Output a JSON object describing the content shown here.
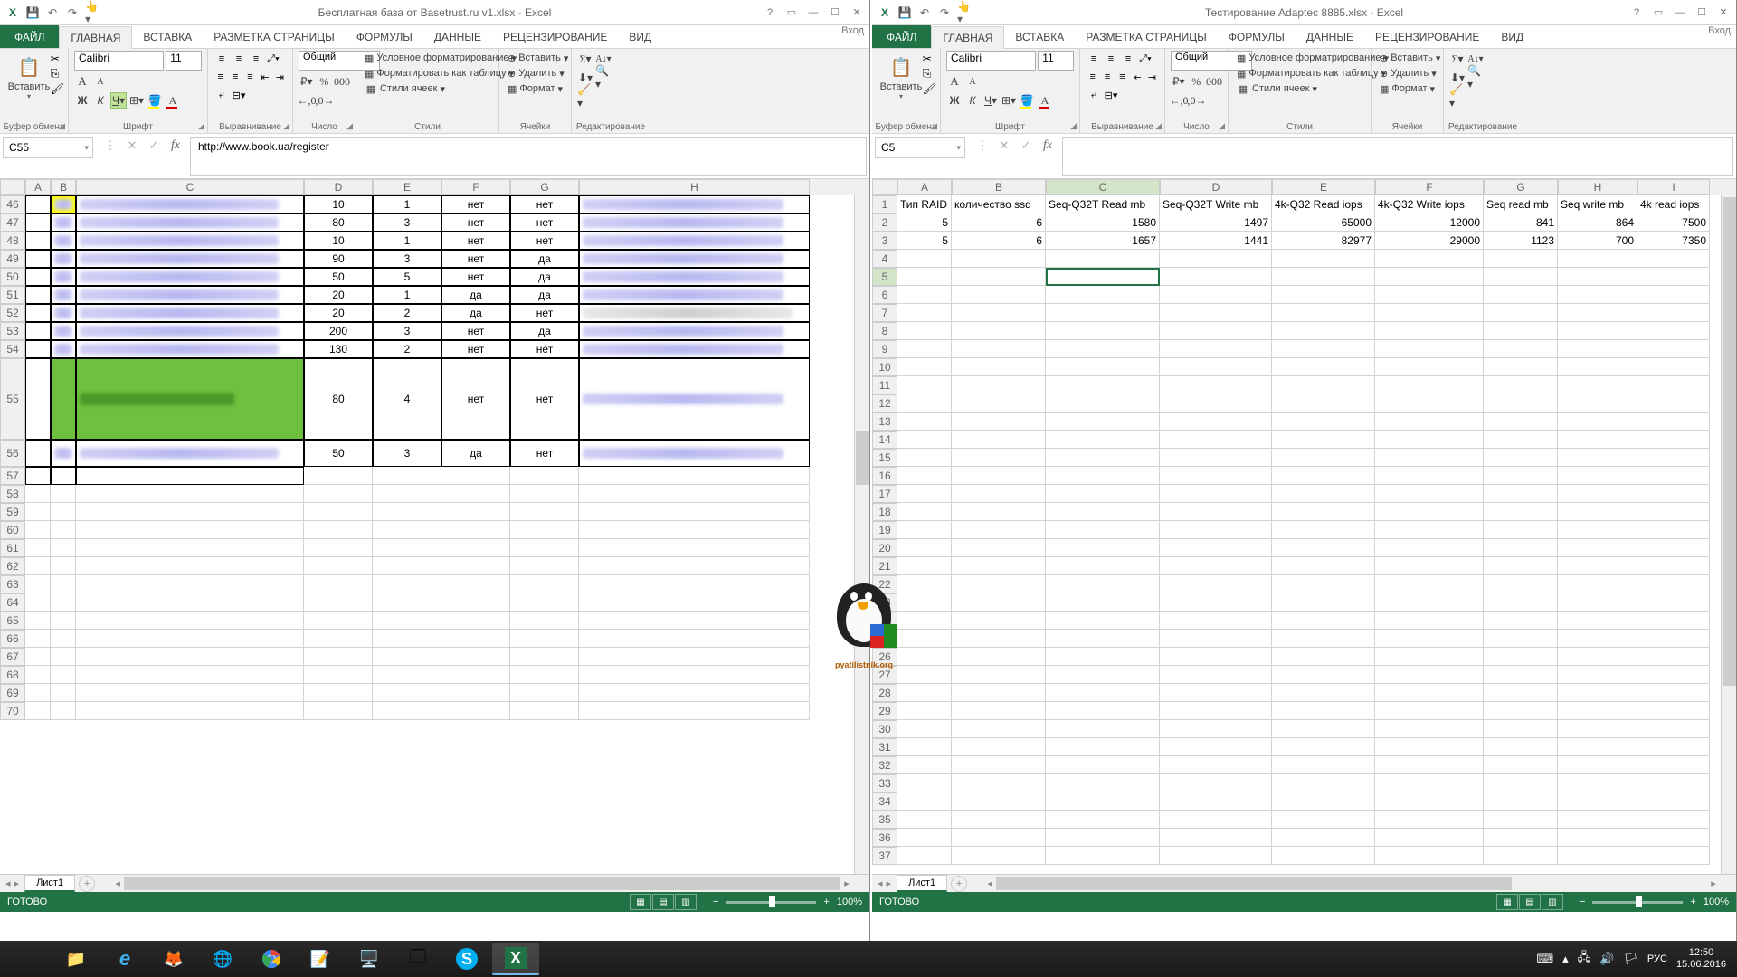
{
  "left": {
    "title": "Бесплатная база от Basetrust.ru v1.xlsx - Excel",
    "signin": "Вход",
    "tabs": {
      "file": "ФАЙЛ",
      "home": "ГЛАВНАЯ",
      "insert": "ВСТАВКА",
      "layout": "РАЗМЕТКА СТРАНИЦЫ",
      "formulas": "ФОРМУЛЫ",
      "data": "ДАННЫЕ",
      "review": "РЕЦЕНЗИРОВАНИЕ",
      "view": "ВИД"
    },
    "ribbon": {
      "paste": "Вставить",
      "clipboard_label": "Буфер обмена",
      "font_name": "Calibri",
      "font_size": "11",
      "font_label": "Шрифт",
      "alignment_label": "Выравнивание",
      "num_format": "Общий",
      "number_label": "Число",
      "cond_fmt": "Условное форматрирование",
      "as_table": "Форматировать как таблицу",
      "cell_styles": "Стили ячеек",
      "styles_label": "Стили",
      "insert": "Вставить",
      "delete": "Удалить",
      "format": "Формат",
      "cells_label": "Ячейки",
      "editing_label": "Редактирование"
    },
    "name_box": "C55",
    "formula": "http://www.book.ua/register",
    "cols": [
      "A",
      "B",
      "C",
      "D",
      "E",
      "F",
      "G",
      "H"
    ],
    "row_nums": [
      46,
      47,
      48,
      49,
      50,
      51,
      52,
      53,
      54,
      55,
      56,
      57,
      58,
      59,
      60,
      61,
      62,
      63,
      64,
      65,
      66,
      67,
      68,
      69,
      70
    ],
    "rows": [
      {
        "n": 46,
        "d": "10",
        "e": "1",
        "f": "нет",
        "g": "нет",
        "hlink": true,
        "yellow": true
      },
      {
        "n": 47,
        "d": "80",
        "e": "3",
        "f": "нет",
        "g": "нет",
        "hlink": true
      },
      {
        "n": 48,
        "d": "10",
        "e": "1",
        "f": "нет",
        "g": "нет",
        "hlink": true
      },
      {
        "n": 49,
        "d": "90",
        "e": "3",
        "f": "нет",
        "g": "да",
        "hlink": true
      },
      {
        "n": 50,
        "d": "50",
        "e": "5",
        "f": "нет",
        "g": "да",
        "hlink": true
      },
      {
        "n": 51,
        "d": "20",
        "e": "1",
        "f": "да",
        "g": "да",
        "hlink": true
      },
      {
        "n": 52,
        "d": "20",
        "e": "2",
        "f": "да",
        "g": "нет",
        "hgrey": true
      },
      {
        "n": 53,
        "d": "200",
        "e": "3",
        "f": "нет",
        "g": "да",
        "hlink": true
      },
      {
        "n": 54,
        "d": "130",
        "e": "2",
        "f": "нет",
        "g": "нет",
        "hlink": true
      },
      {
        "n": 55,
        "d": "80",
        "e": "4",
        "f": "нет",
        "g": "нет",
        "hlink": true,
        "tall": true,
        "green": true
      },
      {
        "n": 56,
        "d": "50",
        "e": "3",
        "f": "да",
        "g": "нет",
        "hlink": true
      }
    ],
    "sheet_tab": "Лист1",
    "status": "ГОТОВО",
    "zoom": "100%"
  },
  "right": {
    "title": "Тестирование Adaptec 8885.xlsx - Excel",
    "signin": "Вход",
    "tabs": {
      "file": "ФАЙЛ",
      "home": "ГЛАВНАЯ",
      "insert": "ВСТАВКА",
      "layout": "РАЗМЕТКА СТРАНИЦЫ",
      "formulas": "ФОРМУЛЫ",
      "data": "ДАННЫЕ",
      "review": "РЕЦЕНЗИРОВАНИЕ",
      "view": "ВИД"
    },
    "ribbon": {
      "paste": "Вставить",
      "clipboard_label": "Буфер обмена",
      "font_name": "Calibri",
      "font_size": "11",
      "font_label": "Шрифт",
      "alignment_label": "Выравнивание",
      "num_format": "Общий",
      "number_label": "Число",
      "cond_fmt": "Условное форматрирование",
      "as_table": "Форматировать как таблицу",
      "cell_styles": "Стили ячеек",
      "styles_label": "Стили",
      "insert": "Вставить",
      "delete": "Удалить",
      "format": "Формат",
      "cells_label": "Ячейки",
      "editing_label": "Редактирование"
    },
    "name_box": "C5",
    "formula": "",
    "cols": [
      "A",
      "B",
      "C",
      "D",
      "E",
      "F",
      "G",
      "H",
      "I"
    ],
    "headers": [
      "Тип RAID",
      "количество ssd",
      "Seq-Q32T Read mb",
      "Seq-Q32T Write mb",
      "4k-Q32 Read iops",
      "4k-Q32 Write iops",
      "Seq read mb",
      "Seq write mb",
      "4k read iops"
    ],
    "data_rows": [
      [
        "5",
        "6",
        "1580",
        "1497",
        "65000",
        "12000",
        "841",
        "864",
        "7500"
      ],
      [
        "5",
        "6",
        "1657",
        "1441",
        "82977",
        "29000",
        "1123",
        "700",
        "7350"
      ]
    ],
    "selected_row": 5,
    "sheet_tab": "Лист1",
    "status": "ГОТОВО",
    "zoom": "100%"
  },
  "taskbar": {
    "lang": "РУС",
    "time": "12:50",
    "date": "15.06.2016"
  },
  "chart_data": {
    "type": "table",
    "title": "Тестирование Adaptec 8885",
    "columns": [
      "Тип RAID",
      "количество ssd",
      "Seq-Q32T Read mb",
      "Seq-Q32T Write mb",
      "4k-Q32 Read iops",
      "4k-Q32 Write iops",
      "Seq read mb",
      "Seq write mb",
      "4k read iops"
    ],
    "rows": [
      [
        5,
        6,
        1580,
        1497,
        65000,
        12000,
        841,
        864,
        7500
      ],
      [
        5,
        6,
        1657,
        1441,
        82977,
        29000,
        1123,
        700,
        7350
      ]
    ]
  }
}
